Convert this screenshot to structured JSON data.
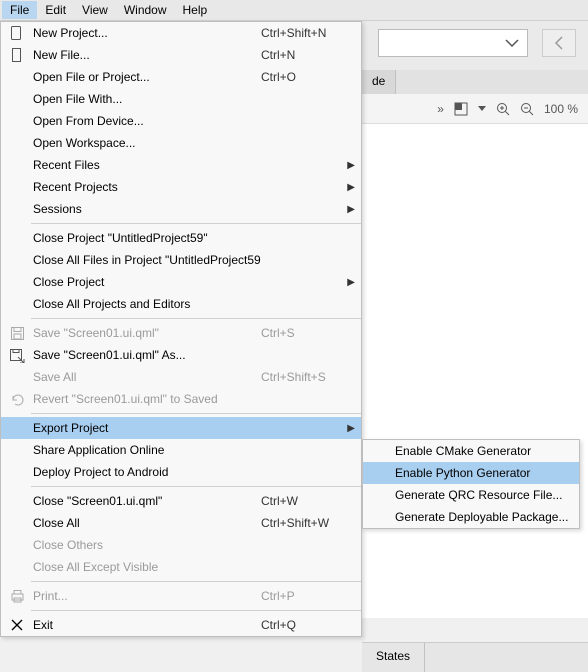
{
  "menubar": [
    "File",
    "Edit",
    "View",
    "Window",
    "Help"
  ],
  "active_menu_index": 0,
  "menu": [
    {
      "icon": "new-project",
      "label": "New Project...",
      "shortcut": "Ctrl+Shift+N"
    },
    {
      "icon": "new-file",
      "label": "New File...",
      "shortcut": "Ctrl+N"
    },
    {
      "label": "Open File or Project...",
      "shortcut": "Ctrl+O"
    },
    {
      "label": "Open File With..."
    },
    {
      "label": "Open From Device..."
    },
    {
      "label": "Open Workspace..."
    },
    {
      "label": "Recent Files",
      "submenu": true
    },
    {
      "label": "Recent Projects",
      "submenu": true
    },
    {
      "label": "Sessions",
      "submenu": true
    },
    {
      "sep": true
    },
    {
      "label": "Close Project \"UntitledProject59\""
    },
    {
      "label": "Close All Files in Project \"UntitledProject59\""
    },
    {
      "label": "Close Project",
      "submenu": true
    },
    {
      "label": "Close All Projects and Editors"
    },
    {
      "sep": true
    },
    {
      "icon": "save",
      "label": "Save \"Screen01.ui.qml\"",
      "shortcut": "Ctrl+S",
      "disabled": true
    },
    {
      "icon": "save-as",
      "label": "Save \"Screen01.ui.qml\" As..."
    },
    {
      "label": "Save All",
      "shortcut": "Ctrl+Shift+S",
      "disabled": true
    },
    {
      "icon": "revert",
      "label": "Revert \"Screen01.ui.qml\" to Saved",
      "disabled": true
    },
    {
      "sep": true
    },
    {
      "label": "Export Project",
      "submenu": true,
      "hover": true
    },
    {
      "label": "Share Application Online"
    },
    {
      "label": "Deploy Project to Android"
    },
    {
      "sep": true
    },
    {
      "label": "Close \"Screen01.ui.qml\"",
      "shortcut": "Ctrl+W"
    },
    {
      "label": "Close All",
      "shortcut": "Ctrl+Shift+W"
    },
    {
      "label": "Close Others",
      "disabled": true
    },
    {
      "label": "Close All Except Visible",
      "disabled": true
    },
    {
      "sep": true
    },
    {
      "icon": "print",
      "label": "Print...",
      "shortcut": "Ctrl+P",
      "disabled": true
    },
    {
      "sep": true
    },
    {
      "icon": "exit",
      "label": "Exit",
      "shortcut": "Ctrl+Q"
    }
  ],
  "submenu": [
    {
      "label": "Enable CMake Generator"
    },
    {
      "label": "Enable Python Generator",
      "hover": true
    },
    {
      "label": "Generate QRC Resource File..."
    },
    {
      "label": "Generate Deployable Package..."
    }
  ],
  "bg": {
    "tab_suffix": "de",
    "zoom": "100 %",
    "states_tab": "States"
  }
}
